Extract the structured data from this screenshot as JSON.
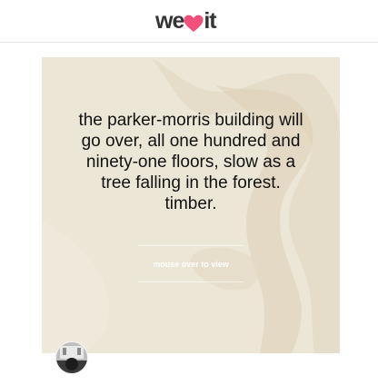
{
  "header": {
    "logo": {
      "text_before": "we",
      "icon": "heart-icon",
      "text_after": "it",
      "brand_color": "#f0507a"
    }
  },
  "card": {
    "quote": "the parker-morris building will\ngo over, all one hundred and\nninety-one floors, slow as a\ntree falling in the forest.\ntimber.",
    "mouseover_label": "mouse over to view",
    "background_color": "#ece6d6"
  },
  "user": {
    "avatar": "avatar"
  }
}
